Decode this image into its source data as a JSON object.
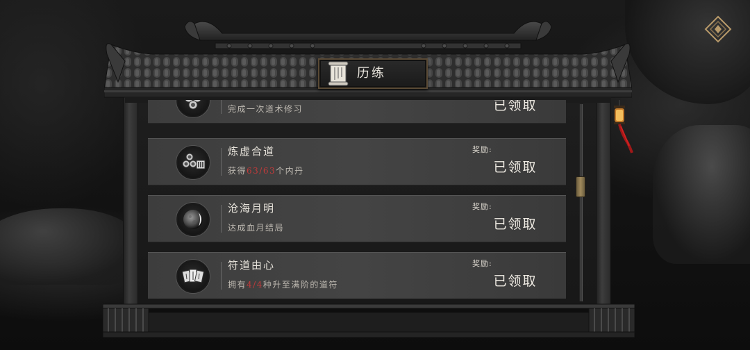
{
  "panel": {
    "title": "历练"
  },
  "tasks": [
    {
      "name": "",
      "desc_pre": "完成一次道术修习",
      "desc_hl": "",
      "desc_post": "",
      "reward_label": "",
      "status": "已领取",
      "icon": "orbs-icon"
    },
    {
      "name": "炼虚合道",
      "desc_pre": "获得",
      "desc_hl": "63/63",
      "desc_post": "个内丹",
      "reward_label": "奖励:",
      "status": "已领取",
      "icon": "orbs-roman-three-icon"
    },
    {
      "name": "沧海月明",
      "desc_pre": "达成血月结局",
      "desc_hl": "",
      "desc_post": "",
      "reward_label": "奖励:",
      "status": "已领取",
      "icon": "moon-icon"
    },
    {
      "name": "符道由心",
      "desc_pre": "拥有",
      "desc_hl": "4/4",
      "desc_post": "种升至满阶的道符",
      "reward_label": "奖励:",
      "status": "已领取",
      "icon": "talisman-cards-icon"
    }
  ],
  "colors": {
    "highlight": "#c23a3a",
    "row_bg": "#424242",
    "text": "#e6e2da",
    "thumb": "#a08a5c"
  },
  "icons": {
    "corner": "diamond-emblem-icon",
    "title": "scroll-icon",
    "lantern": "lantern-icon"
  }
}
